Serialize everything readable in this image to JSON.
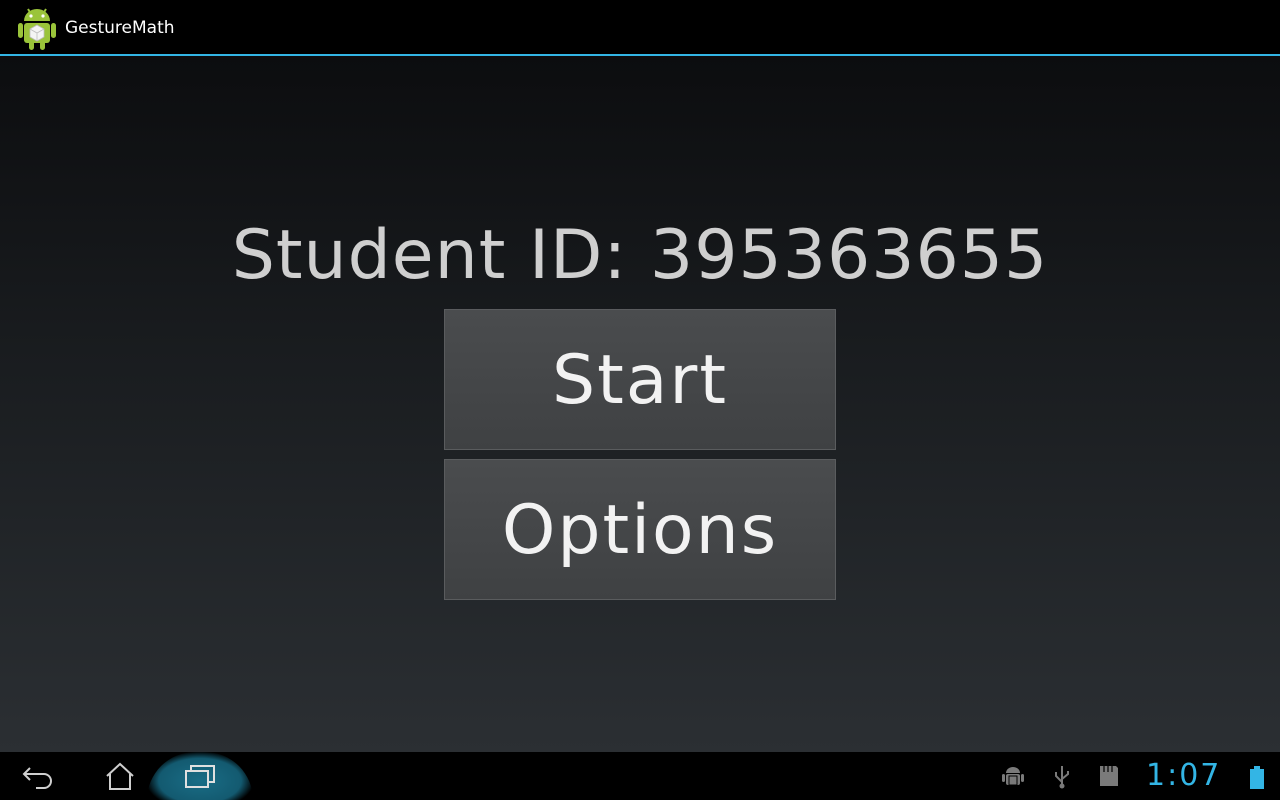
{
  "app": {
    "title": "GestureMath",
    "icon": "android-app-icon"
  },
  "main": {
    "student_id_text": "Student ID: 395363655",
    "start_label": "Start",
    "options_label": "Options"
  },
  "navbar": {
    "back_icon": "back-icon",
    "home_icon": "home-icon",
    "recent_icon": "recent-apps-icon"
  },
  "status_bar": {
    "icons": [
      "android-debug-icon",
      "usb-icon",
      "sd-card-icon",
      "battery-icon"
    ],
    "time": "1:07"
  },
  "colors": {
    "accent": "#33b5e5",
    "button_bg": "#454749",
    "text_light": "#cfcfcf"
  }
}
